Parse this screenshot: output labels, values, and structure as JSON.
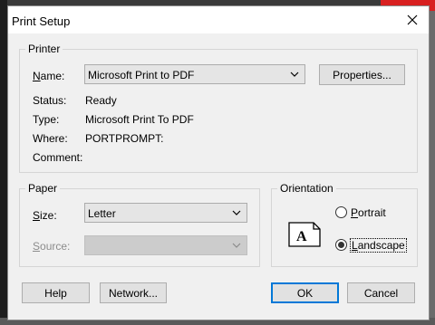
{
  "dialog": {
    "title": "Print Setup"
  },
  "printer": {
    "legend": "Printer",
    "name_label": "Name:",
    "name_value": "Microsoft Print to PDF",
    "properties_button": "Properties...",
    "status_label": "Status:",
    "status_value": "Ready",
    "type_label": "Type:",
    "type_value": "Microsoft Print To PDF",
    "where_label": "Where:",
    "where_value": "PORTPROMPT:",
    "comment_label": "Comment:",
    "comment_value": ""
  },
  "paper": {
    "legend": "Paper",
    "size_label": "Size:",
    "size_value": "Letter",
    "source_label": "Source:",
    "source_value": ""
  },
  "orientation": {
    "legend": "Orientation",
    "icon_letter": "A",
    "portrait_label": "Portrait",
    "landscape_label": "Landscape",
    "selected": "Landscape"
  },
  "buttons": {
    "help": "Help",
    "network": "Network...",
    "ok": "OK",
    "cancel": "Cancel"
  }
}
